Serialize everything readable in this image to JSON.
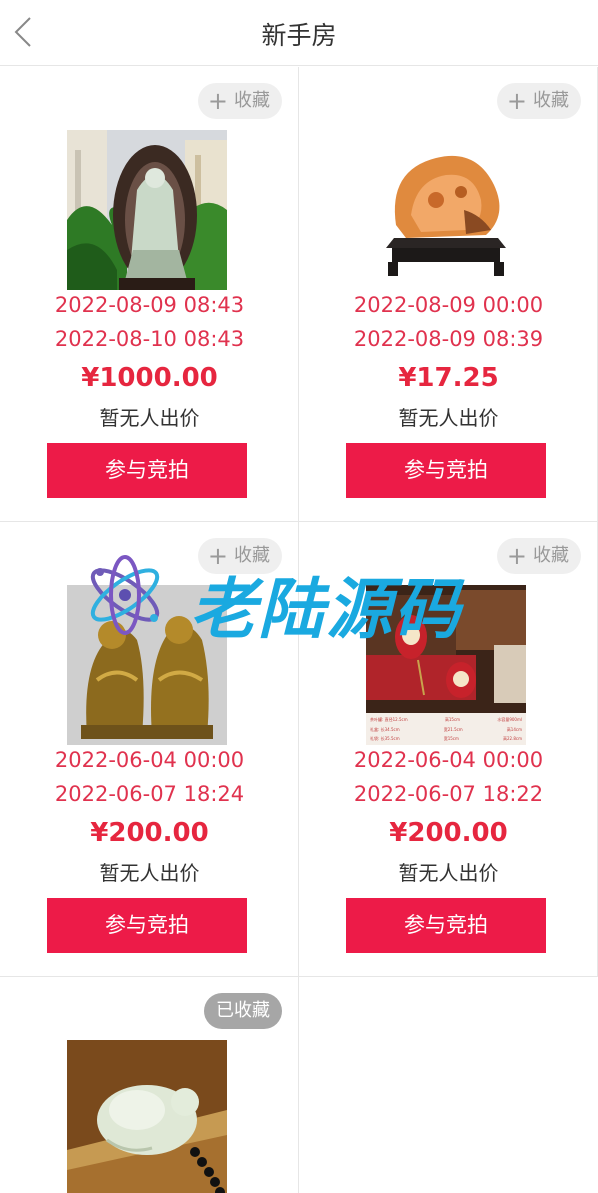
{
  "header": {
    "title": "新手房"
  },
  "items": [
    {
      "fav_label": "收藏",
      "start": "2022-08-09 08:43",
      "end": "2022-08-10 08:43",
      "price": "¥1000.00",
      "bids": "暂无人出价",
      "button": "参与竞拍",
      "favorited": false
    },
    {
      "fav_label": "收藏",
      "start": "2022-08-09 00:00",
      "end": "2022-08-09 08:39",
      "price": "¥17.25",
      "bids": "暂无人出价",
      "button": "参与竞拍",
      "favorited": false
    },
    {
      "fav_label": "收藏",
      "start": "2022-06-04 00:00",
      "end": "2022-06-07 18:24",
      "price": "¥200.00",
      "bids": "暂无人出价",
      "button": "参与竞拍",
      "favorited": false
    },
    {
      "fav_label": "收藏",
      "start": "2022-06-04 00:00",
      "end": "2022-06-07 18:22",
      "price": "¥200.00",
      "bids": "暂无人出价",
      "button": "参与竞拍",
      "favorited": false
    },
    {
      "fav_label": "已收藏",
      "favorited": true
    }
  ],
  "watermark": {
    "text": "老陆源码"
  },
  "colors": {
    "accent": "#ed1b48",
    "time": "#e0324e",
    "watermark": "#1aa9e0"
  },
  "product_image_3_spec": {
    "row1": [
      "茶叶罐: 直径12.5cm",
      "高15cm",
      "水容量900ml"
    ],
    "row2": [
      "礼盒: 长34.5cm",
      "宽21.5cm",
      "高14cm"
    ],
    "row3": [
      "礼袋: 长35.5cm",
      "宽15cm",
      "高22.8cm"
    ]
  }
}
